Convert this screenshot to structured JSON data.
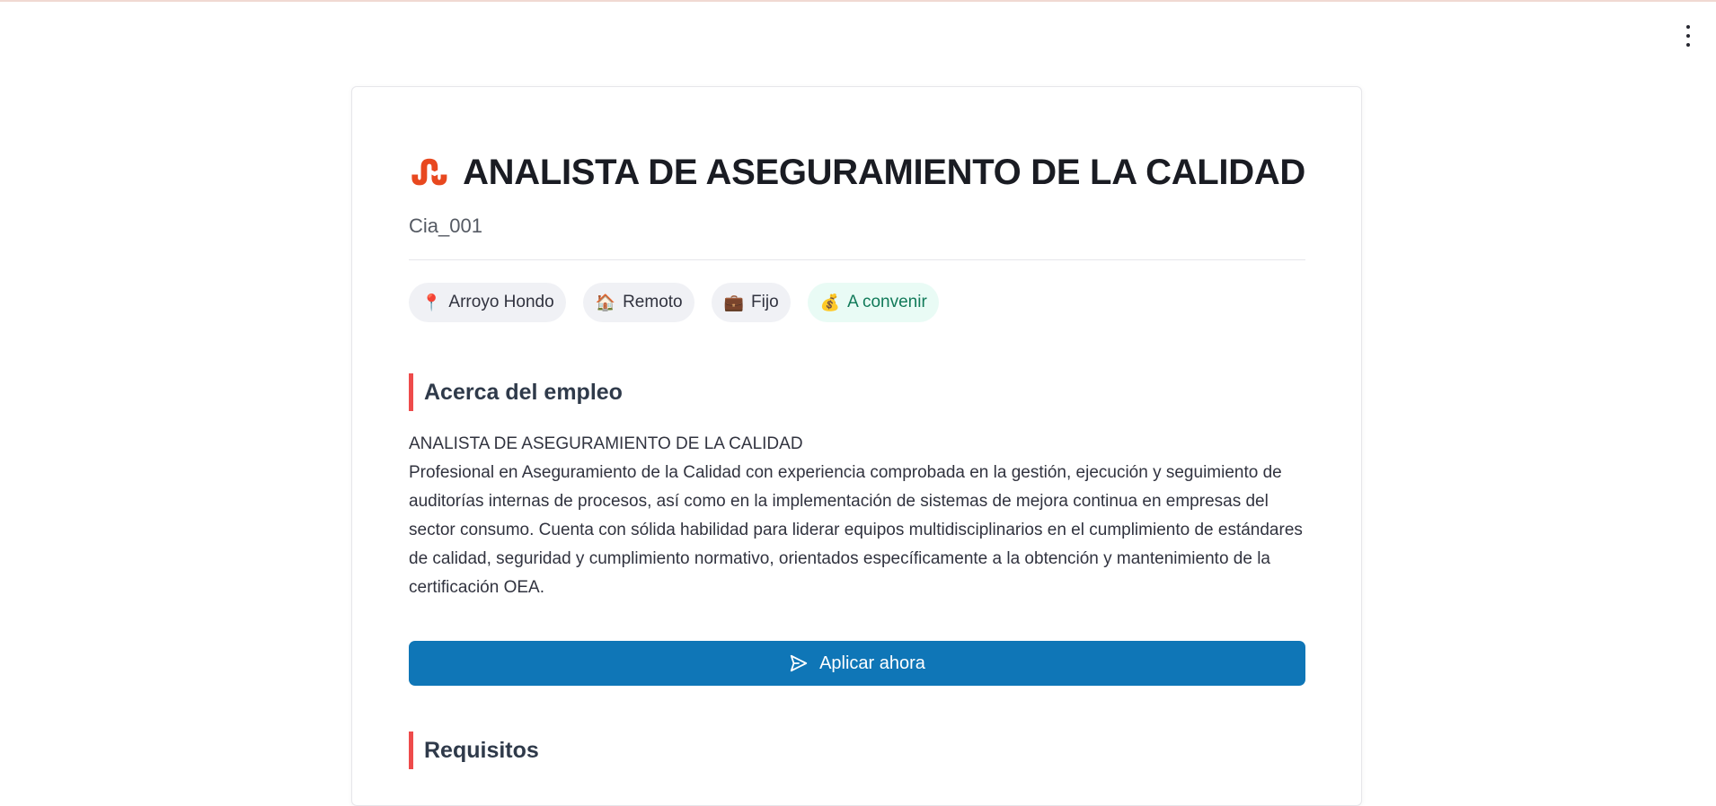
{
  "job": {
    "title": "ANALISTA DE ASEGURAMIENTO DE LA CALIDAD",
    "company": "Cia_001",
    "logo_icon": "stumbleupon-icon",
    "brand_color": "#e8481f",
    "tags": [
      {
        "icon": "📍",
        "label": "Arroyo Hondo"
      },
      {
        "icon": "🏠",
        "label": "Remoto"
      },
      {
        "icon": "💼",
        "label": "Fijo"
      },
      {
        "icon": "💰",
        "label": "A convenir"
      }
    ],
    "about": {
      "heading": "Acerca del empleo",
      "lead": "ANALISTA DE ASEGURAMIENTO DE LA CALIDAD",
      "body": "Profesional en Aseguramiento de la Calidad con experiencia comprobada en la gestión, ejecución y seguimiento de auditorías internas de procesos, así como en la implementación de sistemas de mejora continua en empresas del sector consumo. Cuenta con sólida habilidad para liderar equipos multidisciplinarios en el cumplimiento de estándares de calidad, seguridad y cumplimiento normativo, orientados específicamente a la obtención y mantenimiento de la certificación OEA."
    },
    "apply_label": "Aplicar ahora",
    "requirements_heading": "Requisitos"
  },
  "colors": {
    "accent_bar": "#ee4b4b",
    "apply_button": "#0f76b7",
    "salary_chip_bg": "#e9fbf5",
    "salary_chip_text": "#117a59"
  }
}
